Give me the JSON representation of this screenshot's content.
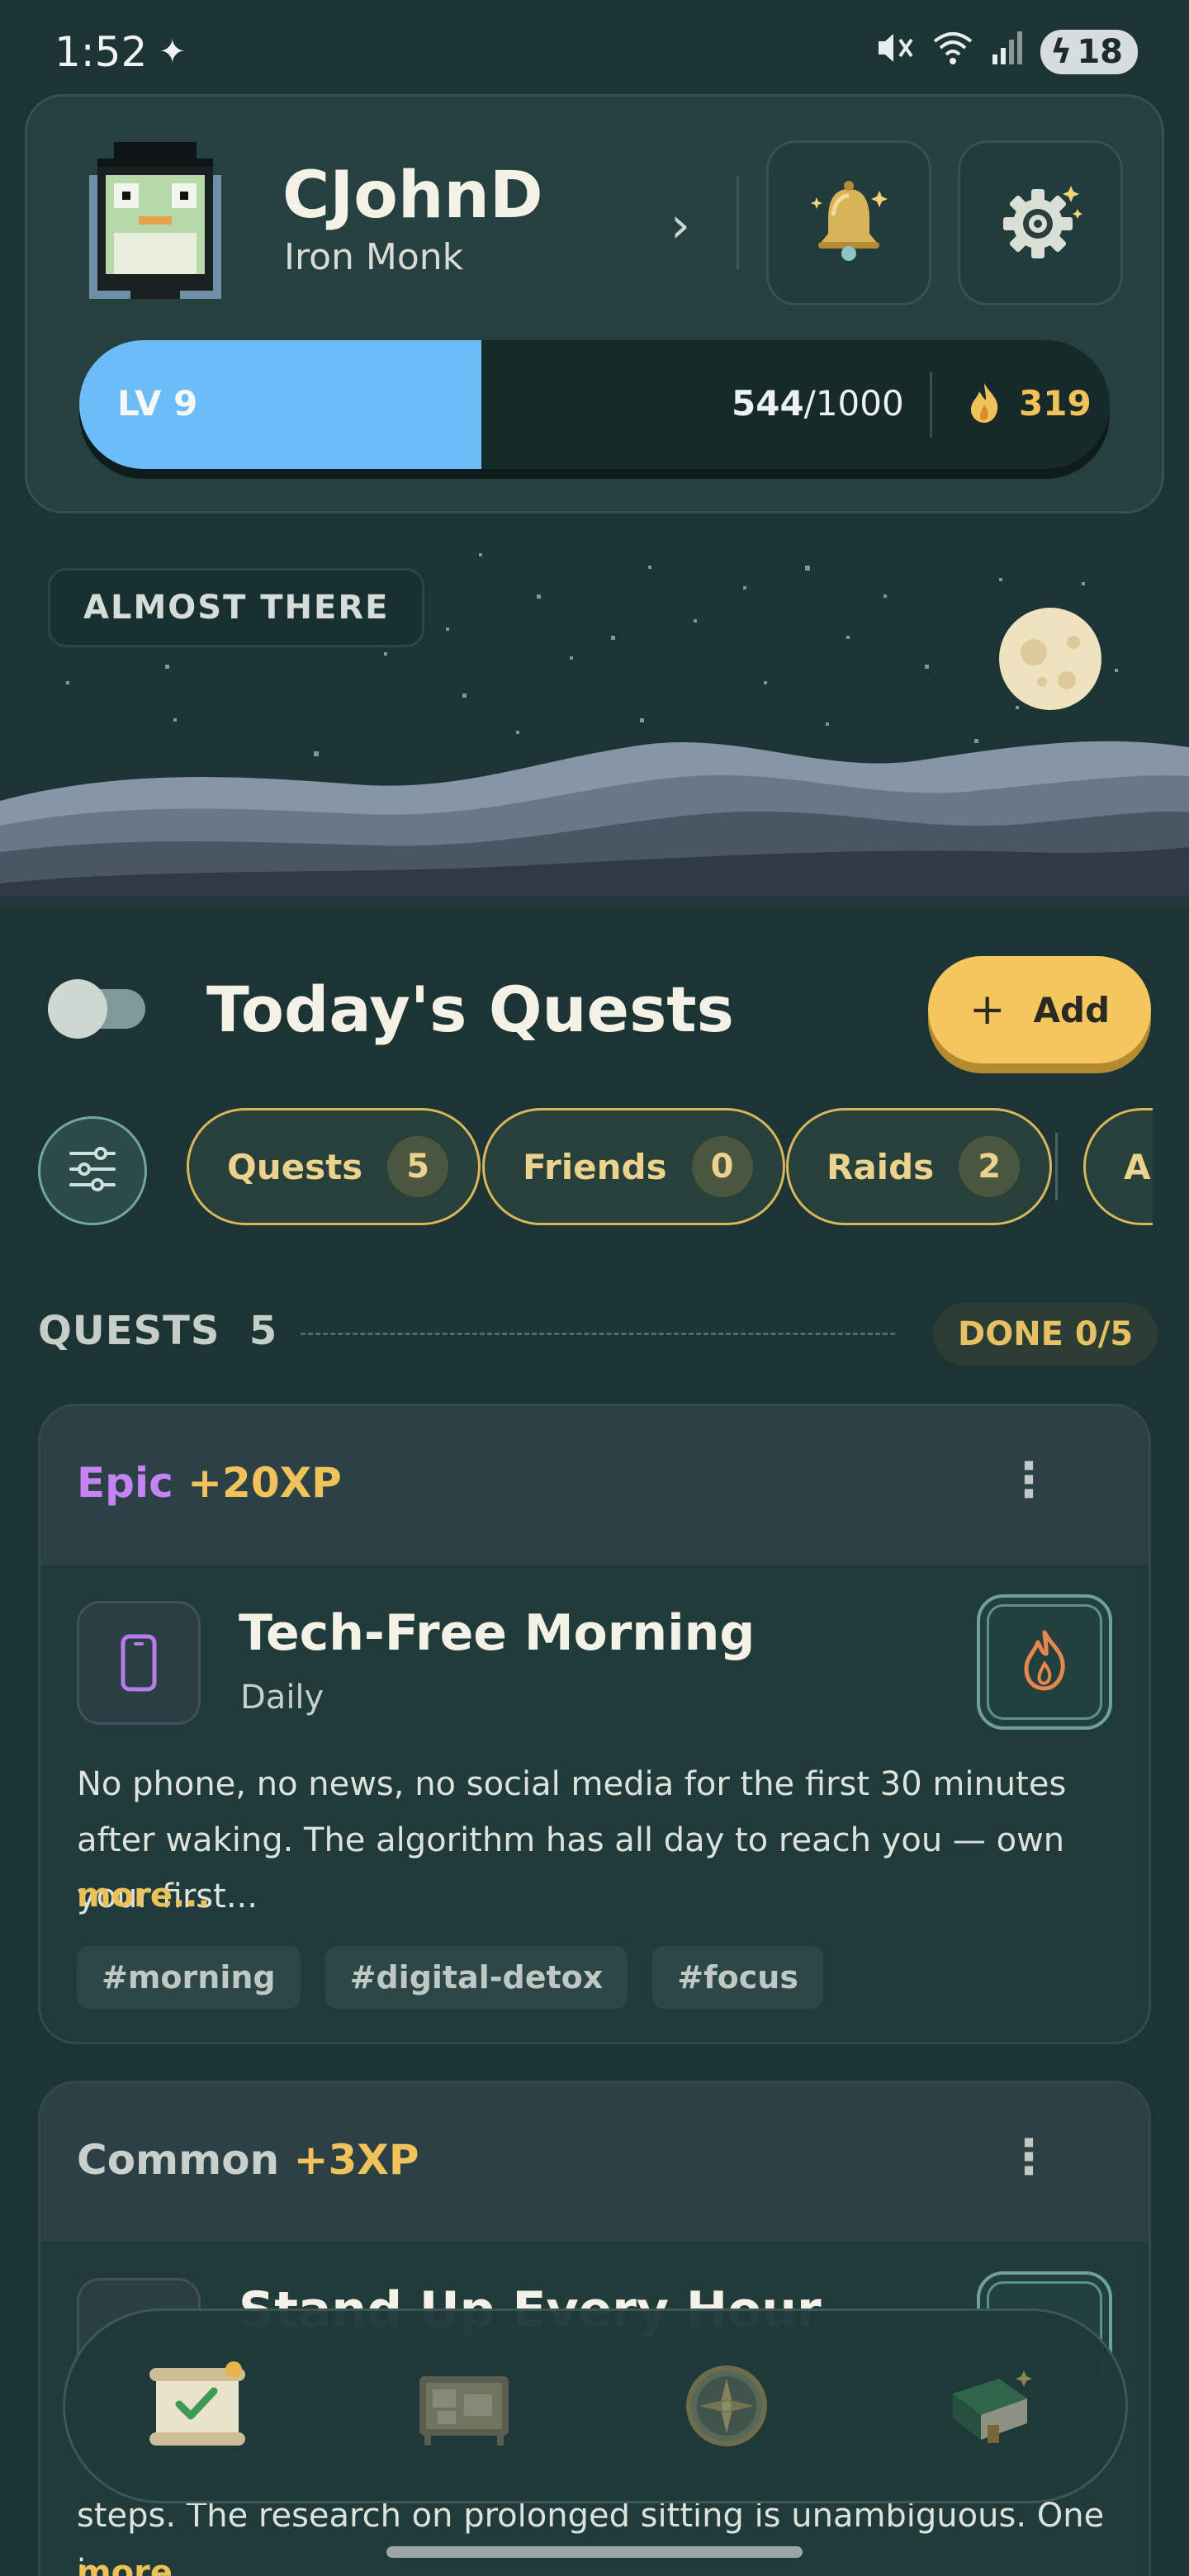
{
  "status_bar": {
    "time": "1:52",
    "battery": "18"
  },
  "profile": {
    "username": "CJohnD",
    "title": "Iron Monk",
    "level_label": "LV 9",
    "xp_current": "544",
    "xp_total": "/1000",
    "xp_progress": 0.39,
    "streak": "319"
  },
  "scene": {
    "badge": "ALMOST THERE"
  },
  "quests_header": {
    "title": "Today's Quests",
    "add_label": "Add"
  },
  "filters": [
    {
      "label": "Quests",
      "count": "5"
    },
    {
      "label": "Friends",
      "count": "0"
    },
    {
      "label": "Raids",
      "count": "2"
    },
    {
      "label": "Al"
    }
  ],
  "section": {
    "label": "QUESTS",
    "count": "5",
    "done": "DONE 0/5"
  },
  "cards": [
    {
      "rarity": "Epic",
      "xp": "+20XP",
      "rarity_color": "#c584f5",
      "name": "Tech-Free Morning",
      "frequency": "Daily",
      "description": "No phone, no news, no social media for the first 30 minutes after waking. The algorithm has all day to reach you — own your first...",
      "more": "more...",
      "tags": [
        "#morning",
        "#digital-detox",
        "#focus"
      ]
    },
    {
      "rarity": "Common",
      "xp": "+3XP",
      "rarity_color": "#c9cfca",
      "name": "Stand Up Every Hour",
      "description": "steps. The research on prolonged sitting is unambiguous. One i...",
      "more": "more..."
    }
  ],
  "colors": {
    "accent_gold": "#f3c65e",
    "xp_blue": "#6cbcf7",
    "background": "#1d3434"
  },
  "nav": {
    "items": [
      "quests-scroll-icon",
      "quest-board-icon",
      "compass-icon",
      "journal-book-icon"
    ]
  }
}
